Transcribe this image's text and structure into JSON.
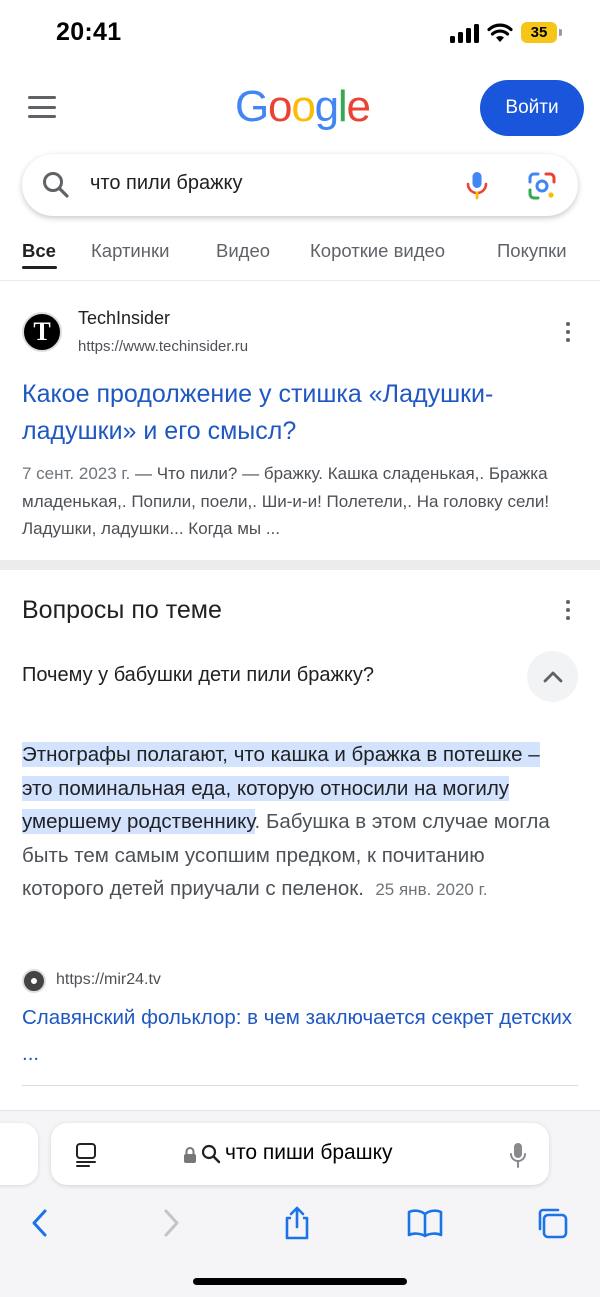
{
  "status_bar": {
    "time": "20:41",
    "battery": "35",
    "icons": [
      "cellular-signal-icon",
      "wifi-icon",
      "battery-icon"
    ]
  },
  "header": {
    "logo": [
      "G",
      "o",
      "o",
      "g",
      "l",
      "e"
    ],
    "logo_colors": [
      "#4285f4",
      "#ea4335",
      "#fbbc05",
      "#4285f4",
      "#34a853",
      "#ea4335"
    ],
    "signin_label": "Войти",
    "accent": "#1a56db"
  },
  "search": {
    "query": "что пили бражку"
  },
  "tabs": [
    "Все",
    "Картинки",
    "Видео",
    "Короткие видео",
    "Покупки"
  ],
  "result": {
    "site_name": "TechInsider",
    "site_url": "https://www.techinsider.ru",
    "favicon_letter": "T",
    "title": "Какое продолжение у стишка «Ладушки-ладушки» и его смысл?",
    "date": "7 сент. 2023 г.",
    "snippet": " — Что пили? — бражку. Кашка сладенькая,. Бражка младенькая,. Попили, поели,. Ши-и-и! Полетели,. На головку сели! Ладушки, ладушки... Когда мы ..."
  },
  "related": {
    "heading": "Вопросы по теме",
    "question": "Почему у бабушки дети пили бражку?",
    "answer_highlight": "Этнографы полагают, что кашка и бражка в потешке – это поминальная еда, которую относили на могилу умершему родственнику",
    "answer_rest": ". Бабушка в этом случае могла быть тем самым усопшим предком, к почитанию которого детей приучали с пеленок.",
    "answer_date": "25 янв. 2020 г.",
    "source_url": "https://mir24.tv",
    "source_title": "Славянский фольклор: в чем заключается секрет детских ..."
  },
  "safari": {
    "address": "что пиши брашку",
    "toolbar": [
      "back-icon",
      "forward-icon",
      "share-icon",
      "bookmarks-icon",
      "tabs-icon"
    ]
  }
}
